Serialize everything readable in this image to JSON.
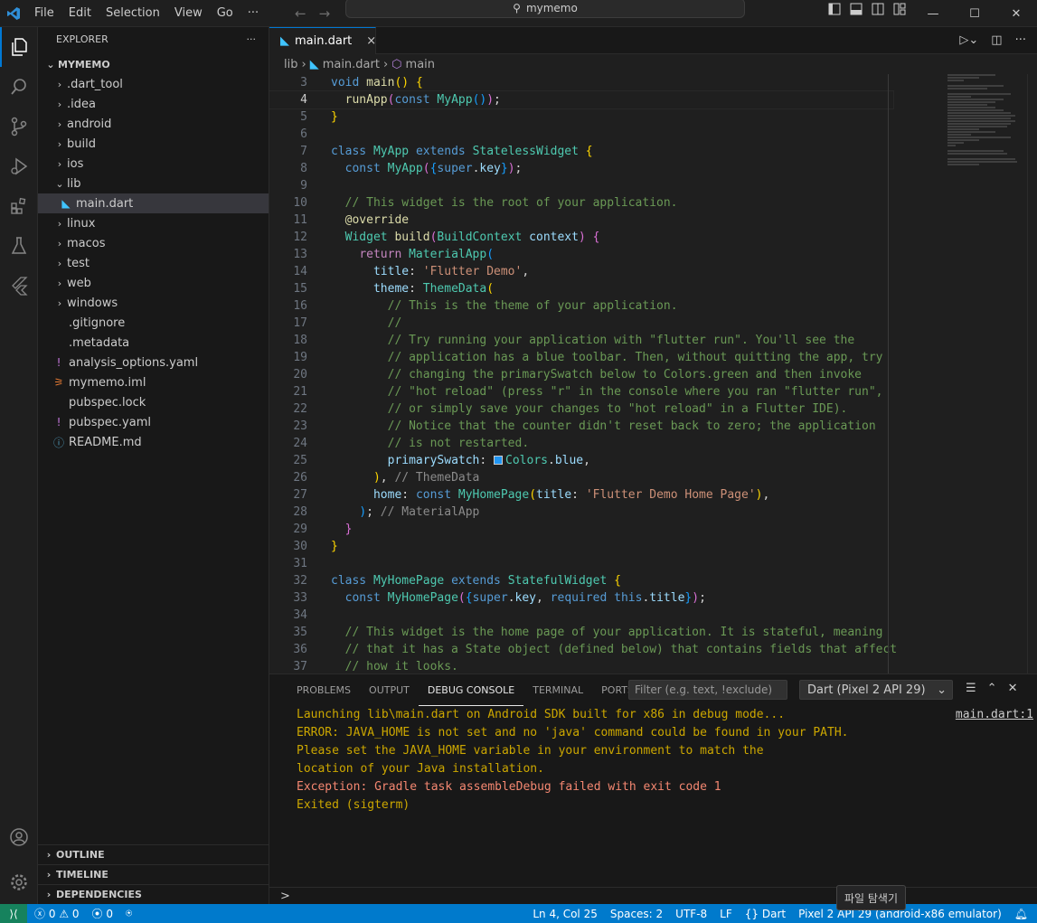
{
  "menu": [
    "File",
    "Edit",
    "Selection",
    "View",
    "Go",
    "···"
  ],
  "search": {
    "label": "mymemo"
  },
  "explorer": {
    "title": "EXPLORER",
    "more": "···",
    "root": "MYMEMO",
    "items": [
      {
        "label": ".dart_tool",
        "type": "folder"
      },
      {
        "label": ".idea",
        "type": "folder"
      },
      {
        "label": "android",
        "type": "folder"
      },
      {
        "label": "build",
        "type": "folder"
      },
      {
        "label": "ios",
        "type": "folder"
      },
      {
        "label": "lib",
        "type": "folder-open"
      },
      {
        "label": "main.dart",
        "type": "dart"
      },
      {
        "label": "linux",
        "type": "folder"
      },
      {
        "label": "macos",
        "type": "folder"
      },
      {
        "label": "test",
        "type": "folder"
      },
      {
        "label": "web",
        "type": "folder"
      },
      {
        "label": "windows",
        "type": "folder"
      },
      {
        "label": ".gitignore",
        "type": "file"
      },
      {
        "label": ".metadata",
        "type": "file"
      },
      {
        "label": "analysis_options.yaml",
        "type": "yaml"
      },
      {
        "label": "mymemo.iml",
        "type": "iml"
      },
      {
        "label": "pubspec.lock",
        "type": "file"
      },
      {
        "label": "pubspec.yaml",
        "type": "yaml"
      },
      {
        "label": "README.md",
        "type": "info"
      }
    ],
    "sections": [
      "OUTLINE",
      "TIMELINE",
      "DEPENDENCIES"
    ]
  },
  "tab": {
    "label": "main.dart",
    "close": "×"
  },
  "breadcrumb": {
    "lib": "lib",
    "file": "main.dart",
    "symbol": "main"
  },
  "panel": {
    "tabs": [
      "PROBLEMS",
      "OUTPUT",
      "DEBUG CONSOLE",
      "TERMINAL",
      "PORTS"
    ],
    "active_tab": "DEBUG CONSOLE",
    "filter_placeholder": "Filter (e.g. text, !exclude)",
    "session": "Dart (Pixel 2 API 29)",
    "source_link": "main.dart:1",
    "lines": [
      {
        "text": "Launching lib\\main.dart on Android SDK built for x86 in debug mode...",
        "kind": "warn"
      },
      {
        "text": "ERROR: JAVA_HOME is not set and no 'java' command could be found in your PATH.",
        "kind": "warn"
      },
      {
        "text": "Please set the JAVA_HOME variable in your environment to match the",
        "kind": "warn"
      },
      {
        "text": "location of your Java installation.",
        "kind": "warn"
      },
      {
        "text": "Exception: Gradle task assembleDebug failed with exit code 1",
        "kind": "err"
      },
      {
        "text": "Exited (sigterm)",
        "kind": "warn"
      }
    ],
    "prompt": ">"
  },
  "status": {
    "errors": "0",
    "warnings": "0",
    "ports": "0",
    "position": "Ln 4, Col 25",
    "spaces": "Spaces: 2",
    "encoding": "UTF-8",
    "eol": "LF",
    "language": "Dart",
    "device": "Pixel 2 API 29 (android-x86 emulator)"
  },
  "tooltip": "파일 탐색기",
  "code_lines": [
    {
      "n": "3",
      "html": "<span class='kw'>void</span> <span class='fn'>main</span><span class='br1'>()</span> <span class='br1'>{</span>"
    },
    {
      "n": "4",
      "html": "  <span class='fn'>runApp</span><span class='br2'>(</span><span class='kw'>const</span> <span class='ty'>MyApp</span><span class='br3'>()</span><span class='br2'>)</span><span class='pl'>;</span>"
    },
    {
      "n": "5",
      "html": "<span class='br1'>}</span>"
    },
    {
      "n": "6",
      "html": ""
    },
    {
      "n": "7",
      "html": "<span class='kw'>class</span> <span class='ty'>MyApp</span> <span class='kw'>extends</span> <span class='ty'>StatelessWidget</span> <span class='br1'>{</span>"
    },
    {
      "n": "8",
      "html": "  <span class='kw'>const</span> <span class='ty'>MyApp</span><span class='br2'>(</span><span class='br3'>{</span><span class='kw'>super</span><span class='pl'>.</span><span class='pr'>key</span><span class='br3'>}</span><span class='br2'>)</span><span class='pl'>;</span>"
    },
    {
      "n": "9",
      "html": ""
    },
    {
      "n": "10",
      "html": "  <span class='cm'>// This widget is the root of your application.</span>"
    },
    {
      "n": "11",
      "html": "  <span class='fn'>@override</span>"
    },
    {
      "n": "12",
      "html": "  <span class='ty'>Widget</span> <span class='fn'>build</span><span class='br2'>(</span><span class='ty'>BuildContext</span> <span class='pr'>context</span><span class='br2'>)</span> <span class='br2'>{</span>"
    },
    {
      "n": "13",
      "html": "    <span class='kw2'>return</span> <span class='ty'>MaterialApp</span><span class='br3'>(</span>"
    },
    {
      "n": "14",
      "html": "      <span class='pr'>title</span><span class='pl'>:</span> <span class='st'>'Flutter Demo'</span><span class='pl'>,</span>"
    },
    {
      "n": "15",
      "html": "      <span class='pr'>theme</span><span class='pl'>:</span> <span class='ty'>ThemeData</span><span class='br1'>(</span>"
    },
    {
      "n": "16",
      "html": "        <span class='cm'>// This is the theme of your application.</span>"
    },
    {
      "n": "17",
      "html": "        <span class='cm'>//</span>"
    },
    {
      "n": "18",
      "html": "        <span class='cm'>// Try running your application with \"flutter run\". You'll see the</span>"
    },
    {
      "n": "19",
      "html": "        <span class='cm'>// application has a blue toolbar. Then, without quitting the app, try</span>"
    },
    {
      "n": "20",
      "html": "        <span class='cm'>// changing the primarySwatch below to Colors.green and then invoke</span>"
    },
    {
      "n": "21",
      "html": "        <span class='cm'>// \"hot reload\" (press \"r\" in the console where you ran \"flutter run\",</span>"
    },
    {
      "n": "22",
      "html": "        <span class='cm'>// or simply save your changes to \"hot reload\" in a Flutter IDE).</span>"
    },
    {
      "n": "23",
      "html": "        <span class='cm'>// Notice that the counter didn't reset back to zero; the application</span>"
    },
    {
      "n": "24",
      "html": "        <span class='cm'>// is not restarted.</span>"
    },
    {
      "n": "25",
      "html": "        <span class='pr'>primarySwatch</span><span class='pl'>:</span> <span class='swatch'></span><span class='ty'>Colors</span><span class='pl'>.</span><span class='pr'>blue</span><span class='pl'>,</span>"
    },
    {
      "n": "26",
      "html": "      <span class='br1'>)</span><span class='pl'>,</span> <span class='cm' style='color:#8b8b8b'>// ThemeData</span>"
    },
    {
      "n": "27",
      "html": "      <span class='pr'>home</span><span class='pl'>:</span> <span class='kw'>const</span> <span class='ty'>MyHomePage</span><span class='br1'>(</span><span class='pr'>title</span><span class='pl'>:</span> <span class='st'>'Flutter Demo Home Page'</span><span class='br1'>)</span><span class='pl'>,</span>"
    },
    {
      "n": "28",
      "html": "    <span class='br3'>)</span><span class='pl'>;</span> <span class='cm' style='color:#8b8b8b'>// MaterialApp</span>"
    },
    {
      "n": "29",
      "html": "  <span class='br2'>}</span>"
    },
    {
      "n": "30",
      "html": "<span class='br1'>}</span>"
    },
    {
      "n": "31",
      "html": ""
    },
    {
      "n": "32",
      "html": "<span class='kw'>class</span> <span class='ty'>MyHomePage</span> <span class='kw'>extends</span> <span class='ty'>StatefulWidget</span> <span class='br1'>{</span>"
    },
    {
      "n": "33",
      "html": "  <span class='kw'>const</span> <span class='ty'>MyHomePage</span><span class='br2'>(</span><span class='br3'>{</span><span class='kw'>super</span><span class='pl'>.</span><span class='pr'>key</span><span class='pl'>,</span> <span class='kw'>required</span> <span class='kw'>this</span><span class='pl'>.</span><span class='pr'>title</span><span class='br3'>}</span><span class='br2'>)</span><span class='pl'>;</span>"
    },
    {
      "n": "34",
      "html": ""
    },
    {
      "n": "35",
      "html": "  <span class='cm'>// This widget is the home page of your application. It is stateful, meaning</span>"
    },
    {
      "n": "36",
      "html": "  <span class='cm'>// that it has a State object (defined below) that contains fields that affect</span>"
    },
    {
      "n": "37",
      "html": "  <span class='cm'>// how it looks.</span>"
    }
  ],
  "colors": {
    "accent": "#0078d4",
    "statusbar": "#007acc",
    "remote": "#16825d"
  }
}
